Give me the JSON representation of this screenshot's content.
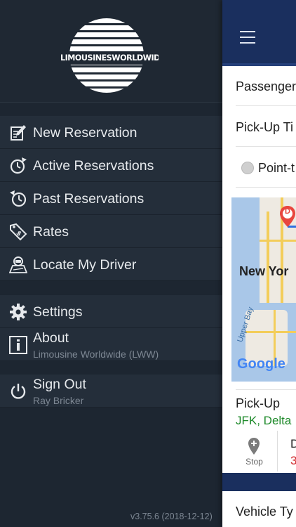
{
  "logo": {
    "text": "LIMOUSINESWORLDWIDE.COM"
  },
  "menu": {
    "new_reservation": "New Reservation",
    "active_reservations": "Active Reservations",
    "past_reservations": "Past Reservations",
    "rates": "Rates",
    "locate_driver": "Locate My Driver",
    "settings": "Settings",
    "about": "About",
    "about_sub": "Limousine Worldwide (LWW)",
    "sign_out": "Sign Out",
    "sign_out_sub": "Ray Bricker"
  },
  "version": "v3.75.6 (2018-12-12)",
  "panel": {
    "passenger": "Passenger",
    "pickup_time": "Pick-Up Ti",
    "point_option": "Point-t",
    "map_city": "New Yor",
    "map_bay": "Upper Bay",
    "map_marker": "D",
    "map_google": "Google",
    "pickup_label": "Pick-Up",
    "pickup_value": "JFK, Delta",
    "stop_label": "Stop",
    "d_label": "D",
    "d_value": "3",
    "vehicle_type": "Vehicle Ty"
  },
  "colors": {
    "drawer_bg": "#1d2631",
    "item_bg": "#242e3a",
    "header_navy": "#1a2f5e",
    "green": "#1e8a2a",
    "red": "#d0282d"
  }
}
